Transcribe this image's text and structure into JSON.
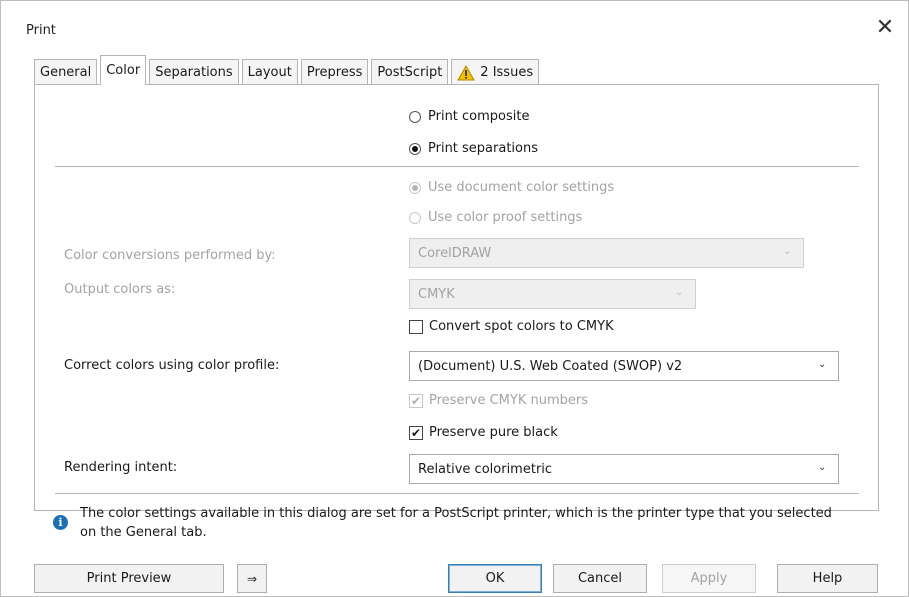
{
  "window": {
    "title": "Print",
    "close_glyph": "✕"
  },
  "tabs": [
    {
      "label": "General",
      "active": false
    },
    {
      "label": "Color",
      "active": true
    },
    {
      "label": "Separations",
      "active": false
    },
    {
      "label": "Layout",
      "active": false
    },
    {
      "label": "Prepress",
      "active": false
    },
    {
      "label": "PostScript",
      "active": false
    },
    {
      "label": "2 Issues",
      "active": false,
      "icon": "warning-icon"
    }
  ],
  "output_mode": {
    "composite_label": "Print composite",
    "separations_label": "Print separations",
    "selected": "separations"
  },
  "color_settings": {
    "use_document_label": "Use document color settings",
    "use_proof_label": "Use color proof settings",
    "selected": "document"
  },
  "conversions": {
    "label": "Color conversions performed by:",
    "value": "CorelDRAW"
  },
  "output_colors": {
    "label": "Output colors as:",
    "value": "CMYK"
  },
  "spot_colors": {
    "label": "Convert spot colors to CMYK",
    "checked": false
  },
  "profile": {
    "label": "Correct colors using color profile:",
    "value": "(Document) U.S. Web Coated (SWOP) v2"
  },
  "preserve_cmyk": {
    "label": "Preserve CMYK numbers",
    "checked": true
  },
  "preserve_black": {
    "label": "Preserve pure black",
    "checked": true
  },
  "rendering_intent": {
    "label": "Rendering intent:",
    "value": "Relative colorimetric"
  },
  "info": {
    "icon": "info-icon",
    "text": "The color settings available in this dialog are set for a PostScript printer, which is the printer type that you selected on the General tab."
  },
  "buttons": {
    "print_preview": "Print Preview",
    "expand_glyph": "⇒",
    "ok": "OK",
    "cancel": "Cancel",
    "apply": "Apply",
    "help": "Help"
  },
  "colors": {
    "warning": "#f2c200",
    "info": "#1b6fb3",
    "disabled_text": "#a3a3a3"
  }
}
